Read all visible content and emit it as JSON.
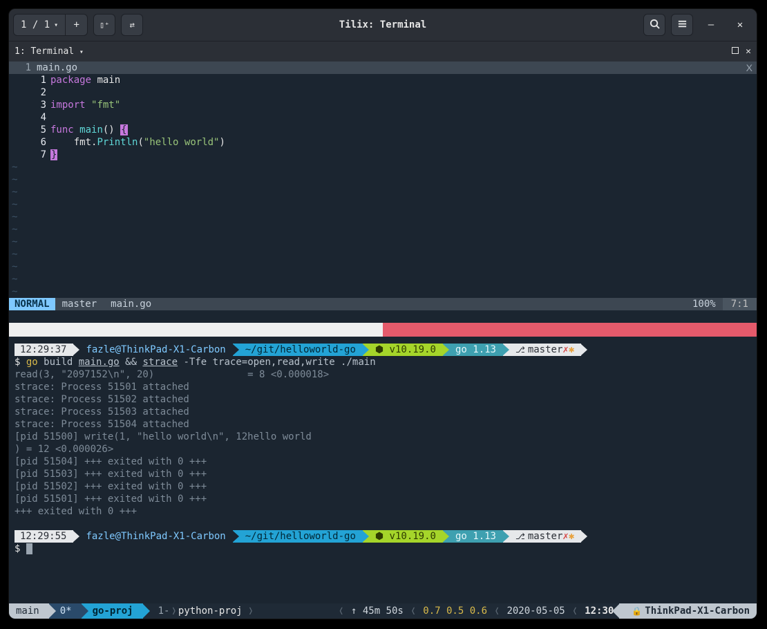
{
  "titlebar": {
    "session_count": "1 / 1",
    "app_title": "Tilix: Terminal"
  },
  "session_tab": {
    "label": "1: Terminal"
  },
  "editor": {
    "buf_gutter": "1",
    "filename": "main.go",
    "close_char": "X",
    "lines": [
      {
        "n": "1",
        "tokens": [
          [
            "kw",
            "package"
          ],
          [
            "sp",
            " "
          ],
          [
            "id",
            "main"
          ]
        ]
      },
      {
        "n": "2",
        "tokens": []
      },
      {
        "n": "3",
        "tokens": [
          [
            "kw",
            "import"
          ],
          [
            "sp",
            " "
          ],
          [
            "str",
            "\"fmt\""
          ]
        ]
      },
      {
        "n": "4",
        "tokens": []
      },
      {
        "n": "5",
        "tokens": [
          [
            "kw",
            "func"
          ],
          [
            "sp",
            " "
          ],
          [
            "fn2",
            "main"
          ],
          [
            "id",
            "()"
          ],
          [
            "sp",
            " "
          ],
          [
            "cursbr",
            "{"
          ]
        ]
      },
      {
        "n": "6",
        "tokens": [
          [
            "sp",
            "    "
          ],
          [
            "id",
            "fmt"
          ],
          [
            "id",
            "."
          ],
          [
            "fn2",
            "Println"
          ],
          [
            "id",
            "("
          ],
          [
            "str",
            "\"hello world\""
          ],
          [
            "id",
            ")"
          ]
        ]
      },
      {
        "n": "7",
        "tokens": [
          [
            "cursbr",
            "}"
          ]
        ]
      }
    ],
    "tilde_count": 11
  },
  "vimstatus": {
    "mode": "NORMAL",
    "branch": "master",
    "file": "main.go",
    "percent": "100%",
    "pos": "7:1"
  },
  "prompt1": {
    "time": "12:29:37",
    "userhost": "fazle@ThinkPad-X1-Carbon",
    "cwd": "~/git/helloworld-go",
    "node": "⬢ v10.19.0",
    "go": "go 1.13",
    "branch": "master"
  },
  "command": {
    "dollar": "$ ",
    "yl_pre": "go ",
    "rest1": "build ",
    "u1": "main.go",
    "mid": " && ",
    "u2": "strace",
    "rest2": " -Tfe trace=open,read,write ./main"
  },
  "output": [
    "read(3, \"2097152\\n\", 20)                = 8 <0.000018>",
    "strace: Process 51501 attached",
    "strace: Process 51502 attached",
    "strace: Process 51503 attached",
    "strace: Process 51504 attached",
    "[pid 51500] write(1, \"hello world\\n\", 12hello world",
    ") = 12 <0.000026>",
    "[pid 51504] +++ exited with 0 +++",
    "[pid 51503] +++ exited with 0 +++",
    "[pid 51502] +++ exited with 0 +++",
    "[pid 51501] +++ exited with 0 +++",
    "+++ exited with 0 +++"
  ],
  "prompt2": {
    "time": "12:29:55",
    "userhost": "fazle@ThinkPad-X1-Carbon",
    "cwd": "~/git/helloworld-go",
    "node": "⬢ v10.19.0",
    "go": "go 1.13",
    "branch": "master"
  },
  "dollar2": "$ ",
  "tmux": {
    "session": "main",
    "win_active_idx": "0*",
    "win_active": "go-proj",
    "win2_idx": "1-",
    "win2": "python-proj",
    "uptime": "↑  45m 50s",
    "load": "0.7 0.5 0.6",
    "date": "2020-05-05",
    "clock": "12:30",
    "host": "ThinkPad-X1-Carbon"
  }
}
